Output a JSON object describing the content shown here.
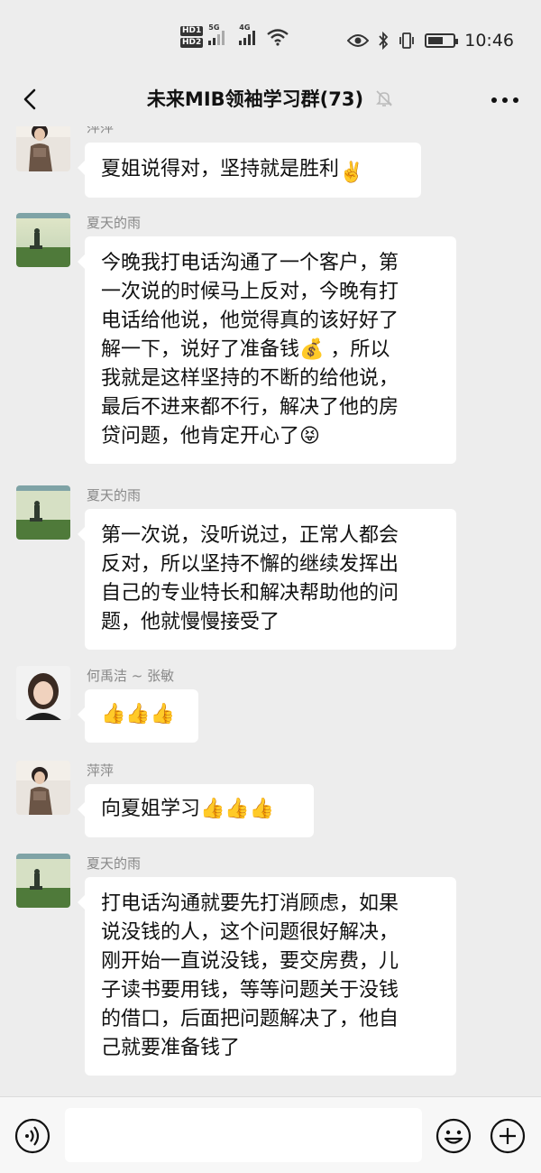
{
  "status_bar": {
    "hd1": "HD1",
    "hd2": "HD2",
    "net1": "5G",
    "net2": "4G",
    "time": "10:46",
    "battery_level": 0.6,
    "icons": [
      "eye-icon",
      "bluetooth-icon",
      "vibrate-icon",
      "battery-icon",
      "wifi-icon"
    ]
  },
  "header": {
    "title": "未来MIB领袖学习群(73)",
    "back_icon": "chevron-left-icon",
    "mute_icon": "bell-off-icon",
    "more_icon": "more-horizontal-icon"
  },
  "messages": [
    {
      "sender": "萍萍",
      "text": "夏姐说得对，坚持就是胜利",
      "emoji": "✌️"
    },
    {
      "sender": "夏天的雨",
      "lines": [
        "今晚我打电话沟通了一个客户，第",
        "一次说的时候马上反对，今晚有打",
        "电话给他说，他觉得真的该好好了",
        "解一下，说好了准备钱💰 ，所以",
        "我就是这样坚持的不断的给他说，",
        "最后不进来都不行，解决了他的房",
        "贷问题，他肯定开心了😝"
      ]
    },
    {
      "sender": "夏天的雨",
      "lines": [
        "第一次说，没听说过，正常人都会",
        "反对，所以坚持不懈的继续发挥出",
        "自己的专业特长和解决帮助他的问",
        "题，他就慢慢接受了"
      ]
    },
    {
      "sender": "何禹洁 ~ 张敏",
      "text": "👍👍👍"
    },
    {
      "sender": "萍萍",
      "text": "向夏姐学习👍👍👍"
    },
    {
      "sender": "夏天的雨",
      "lines": [
        "打电话沟通就要先打消顾虑，如果",
        "说没钱的人，这个问题很好解决，",
        "刚开始一直说没钱，要交房费，儿",
        "子读书要用钱，等等问题关于没钱",
        "的借口，后面把问题解决了，他自",
        "己就要准备钱了"
      ]
    }
  ],
  "input_bar": {
    "voice_icon": "voice-icon",
    "input_value": "",
    "emoji_icon": "smiley-icon",
    "plus_icon": "plus-circle-icon"
  },
  "colors": {
    "background": "#ededed",
    "bubble": "#ffffff",
    "sender_text": "#888888"
  }
}
